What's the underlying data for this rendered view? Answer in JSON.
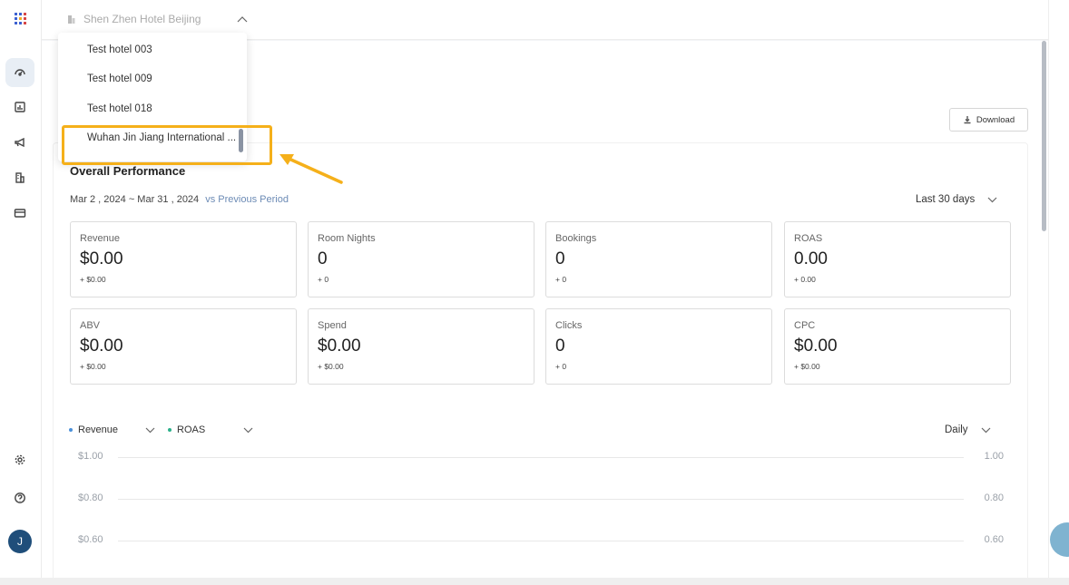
{
  "topbar": {
    "selected_hotel": "Shen Zhen Hotel Beijing"
  },
  "dropdown": {
    "options": [
      "Test hotel 003",
      "Test hotel 009",
      "Test hotel 018",
      "Wuhan Jin Jiang International ..."
    ]
  },
  "toolbar": {
    "download_label": "Download"
  },
  "overview": {
    "title": "Overall Performance",
    "date_range": "Mar 2 , 2024 ~ Mar 31 , 2024",
    "vs_label": "vs  Previous Period",
    "range_select": "Last 30 days"
  },
  "metrics": [
    {
      "label": "Revenue",
      "value": "$0.00",
      "delta": "+ $0.00"
    },
    {
      "label": "Room Nights",
      "value": "0",
      "delta": "+ 0"
    },
    {
      "label": "Bookings",
      "value": "0",
      "delta": "+ 0"
    },
    {
      "label": "ROAS",
      "value": "0.00",
      "delta": "+ 0.00"
    },
    {
      "label": "ABV",
      "value": "$0.00",
      "delta": "+ $0.00"
    },
    {
      "label": "Spend",
      "value": "$0.00",
      "delta": "+ $0.00"
    },
    {
      "label": "Clicks",
      "value": "0",
      "delta": "+ 0"
    },
    {
      "label": "CPC",
      "value": "$0.00",
      "delta": "+ $0.00"
    }
  ],
  "chart": {
    "legend": [
      {
        "name": "Revenue",
        "color": "#4a90d9"
      },
      {
        "name": "ROAS",
        "color": "#2bb08a"
      }
    ],
    "granularity": "Daily",
    "left_ticks": [
      "$1.00",
      "$0.80",
      "$0.60"
    ],
    "right_ticks": [
      "1.00",
      "0.80",
      "0.60"
    ]
  },
  "user": {
    "initial": "J"
  },
  "colors": {
    "accent": "#1f4e7a",
    "highlight": "#f5b01a"
  }
}
